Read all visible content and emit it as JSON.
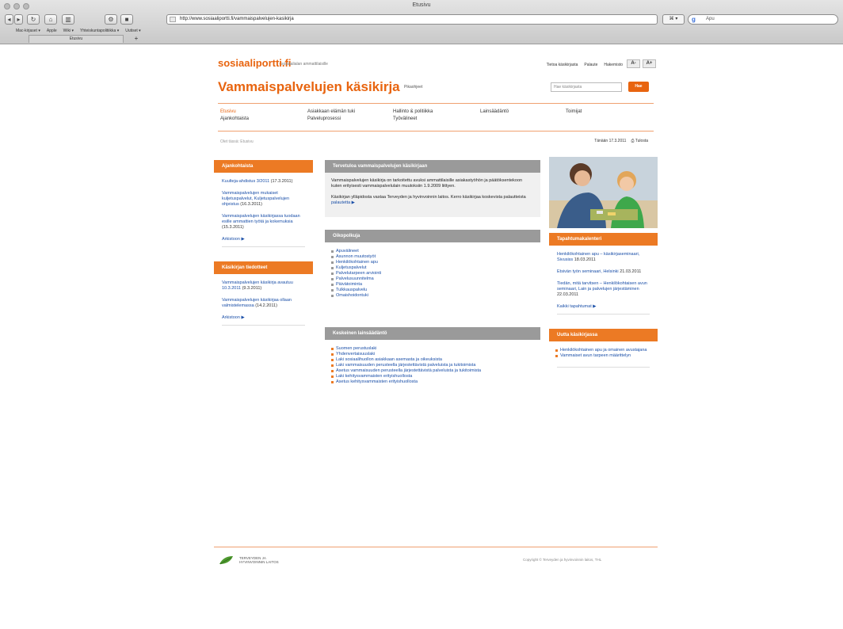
{
  "browser": {
    "window_title": "Etusivu",
    "url": "http://www.sosiaaliportti.fi/vammaispalvelujen-kasikirja",
    "rss_label": "⌘ ▾",
    "search_placeholder": "Apu",
    "bookmarks": [
      "Mac-kirjaset ▾",
      "Apple",
      "Wiki ▾",
      "Yhteiskuntapolitiikka ▾",
      "Uutiset ▾"
    ],
    "tab_label": "Etusivu",
    "tab_add": "+"
  },
  "header": {
    "brand": "sosiaaliportti.fi",
    "brand_sub": "- sosiaalialan ammattilaisille",
    "toplinks": [
      "Tietoa käsikirjasta",
      "Palaute",
      "Hakemisto"
    ],
    "font_small": "A-",
    "font_large": "A+",
    "title": "Vammaispalvelujen käsikirja",
    "title_tag": "Pikaohjeet",
    "search_placeholder": "Hae käsikirjasta",
    "search_button": "Hae"
  },
  "nav": {
    "col1": [
      "Etusivu",
      "Ajankohtaista"
    ],
    "col2": [
      "Asiakkaan elämän tuki",
      "Palveluprosessi"
    ],
    "col3": [
      "Hallinto & politiikka",
      "Työvälineet"
    ],
    "col4": [
      "Lainsäädäntö"
    ],
    "col5": [
      "Toimijat"
    ]
  },
  "breadcrumb": "Olet tässä: Etusivu",
  "date": "Tänään 17.3.2011",
  "print_label": "Tulosta",
  "left": {
    "news_title": "Ajankohtaista",
    "news": [
      {
        "text": "Kuulteja-ahdistus 3/2011",
        "date": "(17.3.2011)"
      },
      {
        "text": "Vammaispalvelujen mukaiset kuljetuspalvelut, Kuljetuspalvelujen ohjeistus",
        "date": "(16.3.2011)"
      },
      {
        "text": "Vammaispalvelujen käsikirjassa tuodaan esille ammattien työtä ja kokemuksia",
        "date": "(15.3.2011)"
      }
    ],
    "news_more": "Arkistoon ▶",
    "updates_title": "Käsikirjan tiedotteet",
    "updates": [
      {
        "text": "Vammaispalvelujen käsikirja avautuu 10.3.2011",
        "date": "(9.3.2011)"
      },
      {
        "text": "Vammaispalvelujen käsikirjaa ollaan valmistelemassa",
        "date": "(14.2.2011)"
      }
    ],
    "updates_more": "Arkistoon ▶"
  },
  "center": {
    "intro_title": "Tervetuloa vammaispalvelujen käsikirjaan",
    "intro_p1": "Vammaispalvelujen käsikirja on tarkoitettu avuksi ammattilaisille asiakastyöhön ja päätöksentekoon kuten erityisesti vammaispalvelulain muutoksiin 1.9.2009 liittyen.",
    "intro_p2": "Käsikirjan ylläpidosta vastaa Terveyden ja hyvinvoinnin laitos. Kerro käsikirjaa koskevista palautteista",
    "intro_link": "palautetta ▶",
    "shortcuts_title": "Oikopolkuja",
    "shortcuts": [
      "Apuvälineet",
      "Asunnon muutostyöt",
      "Henkilökohtainen apu",
      "Kuljetuspalvelut",
      "Palvelutarpeen arviointi",
      "Palvelusuunnitelma",
      "Päivätoiminta",
      "Tulkkauspalvelu",
      "Omaishoidontuki"
    ],
    "laws_title": "Keskeinen lainsäädäntö",
    "laws": [
      "Suomen perustuslaki",
      "Yhdenvertaisuuslaki",
      "Laki sosiaalihuollon asiakkaan asemasta ja oikeuksista",
      "Laki vammaisuuden perusteella järjestettävistä palveluista ja tukitoimista",
      "Asetus vammaisuuden perusteella järjestettävistä palveluista ja tukitoimista",
      "Laki kehitysvammaisten erityishuollosta",
      "Asetus kehitysvammaisten erityishuollosta"
    ]
  },
  "right": {
    "photo_alt": "adult-and-child-photo",
    "events_title": "Tapahtumakalenteri",
    "events": [
      {
        "text": "Henkilökohtainen apu – käsikirjaseminaari, Sivusiss",
        "date": "18.03.2011"
      },
      {
        "text": "Etsivän työn seminaari, Helsinki",
        "date": "21.03.2011"
      },
      {
        "text": "Tiedän, mitä tarvitsen – Henkilökohtaisen avun seminaari, Lain ja palvelujen järjestäminen",
        "date": "22.03.2011"
      }
    ],
    "events_more": "Kaikki tapahtumat ▶",
    "new_title": "Uutta käsikirjassa",
    "new_items": [
      "Henkilökohtainen apu ja omainen avustajana",
      "Vammaiset avun tarpeen määrittelyn"
    ]
  },
  "footer": {
    "org_line1": "TERVEYDEN JA",
    "org_line2": "HYVINVOINNIN LAITOS",
    "copyright": "Copyright © Terveyden ja hyvinvoinnin laitos, THL"
  },
  "colors": {
    "accent": "#e8640f",
    "box_orange": "#ec7a24",
    "box_grey": "#9a9a9a",
    "link": "#1a4fa8"
  }
}
